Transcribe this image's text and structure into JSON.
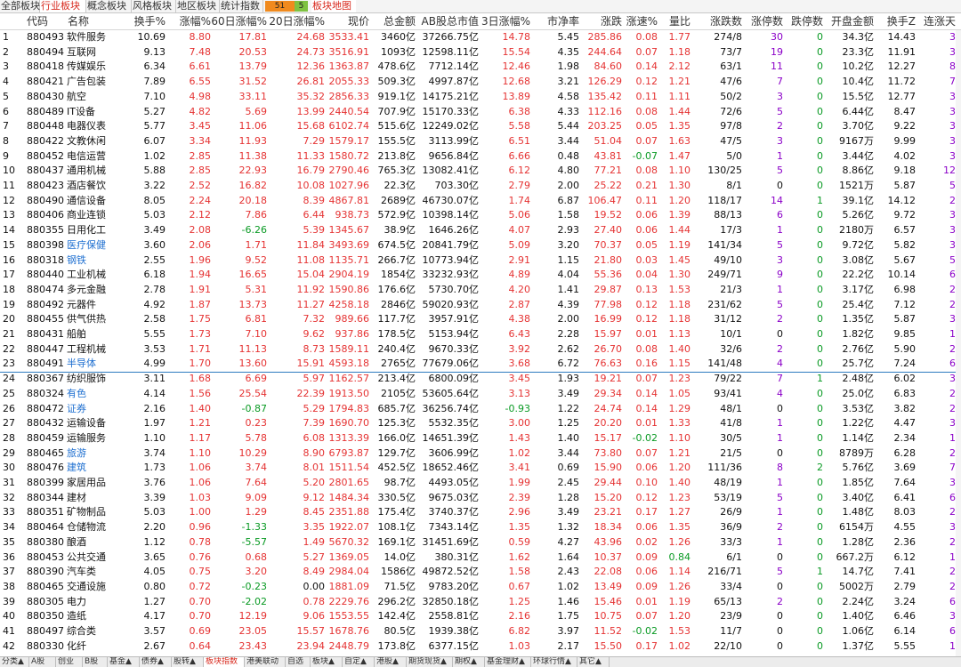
{
  "top_tabs": [
    "全部板块",
    "行业板块",
    "概念板块",
    "风格板块",
    "地区板块",
    "统计指数"
  ],
  "top_tab_extra": "板块地图",
  "badges": {
    "up": "51",
    "down": "5"
  },
  "colors": {
    "up": "#e53333",
    "down": "#0a9a24",
    "selected": "#2e7cc0",
    "accent": "#d82a1e"
  },
  "headers": [
    "代码",
    "名称",
    "换手%",
    "涨幅%",
    "60日涨幅%",
    "20日涨幅%",
    "现价",
    "总金额",
    "AB股总市值",
    "3日涨幅%",
    "市净率",
    "涨跌",
    "涨速%",
    "量比",
    "涨跌数",
    "涨停数",
    "跌停数",
    "开盘金额",
    "换手Z",
    "连涨天"
  ],
  "rows": [
    [
      "1",
      "880493",
      "软件服务",
      "10.69",
      "8.80",
      "17.81",
      "24.68",
      "3533.41",
      "3460亿",
      "37266.75亿",
      "14.78",
      "5.45",
      "285.86",
      "0.08",
      "1.77",
      "274/8",
      "30",
      "0",
      "34.3亿",
      "14.43",
      "3"
    ],
    [
      "2",
      "880494",
      "互联网",
      "9.13",
      "7.48",
      "20.53",
      "24.73",
      "3516.91",
      "1093亿",
      "12598.11亿",
      "15.54",
      "4.35",
      "244.64",
      "0.07",
      "1.18",
      "73/7",
      "19",
      "0",
      "23.3亿",
      "11.91",
      "3"
    ],
    [
      "3",
      "880418",
      "传媒娱乐",
      "6.34",
      "6.61",
      "13.79",
      "12.36",
      "1363.87",
      "478.6亿",
      "7712.14亿",
      "12.46",
      "1.98",
      "84.60",
      "0.14",
      "2.12",
      "63/1",
      "11",
      "0",
      "10.2亿",
      "12.27",
      "8"
    ],
    [
      "4",
      "880421",
      "广告包装",
      "7.89",
      "6.55",
      "31.52",
      "26.81",
      "2055.33",
      "509.3亿",
      "4997.87亿",
      "12.68",
      "3.21",
      "126.29",
      "0.12",
      "1.21",
      "47/6",
      "7",
      "0",
      "10.4亿",
      "11.72",
      "7"
    ],
    [
      "5",
      "880430",
      "航空",
      "7.10",
      "4.98",
      "33.11",
      "35.32",
      "2856.33",
      "919.1亿",
      "14175.21亿",
      "13.89",
      "4.58",
      "135.42",
      "0.11",
      "1.11",
      "50/2",
      "3",
      "0",
      "15.5亿",
      "12.77",
      "3"
    ],
    [
      "6",
      "880489",
      "IT设备",
      "5.27",
      "4.82",
      "5.69",
      "13.99",
      "2440.54",
      "707.9亿",
      "15170.33亿",
      "6.38",
      "4.33",
      "112.16",
      "0.08",
      "1.44",
      "72/6",
      "5",
      "0",
      "6.44亿",
      "8.47",
      "3"
    ],
    [
      "7",
      "880448",
      "电器仪表",
      "5.77",
      "3.45",
      "11.06",
      "15.68",
      "6102.74",
      "515.6亿",
      "12249.02亿",
      "5.58",
      "5.44",
      "203.25",
      "0.05",
      "1.35",
      "97/8",
      "2",
      "0",
      "3.70亿",
      "9.22",
      "3"
    ],
    [
      "8",
      "880422",
      "文教休闲",
      "6.07",
      "3.34",
      "11.93",
      "7.29",
      "1579.17",
      "155.5亿",
      "3113.99亿",
      "6.51",
      "3.44",
      "51.04",
      "0.07",
      "1.63",
      "47/5",
      "3",
      "0",
      "9167万",
      "9.99",
      "3"
    ],
    [
      "9",
      "880452",
      "电信运营",
      "1.02",
      "2.85",
      "11.38",
      "11.33",
      "1580.72",
      "213.8亿",
      "9656.84亿",
      "6.66",
      "0.48",
      "43.81",
      "-0.07",
      "1.47",
      "5/0",
      "1",
      "0",
      "3.44亿",
      "4.02",
      "3"
    ],
    [
      "10",
      "880437",
      "通用机械",
      "5.88",
      "2.85",
      "22.93",
      "16.79",
      "2790.46",
      "765.3亿",
      "13082.41亿",
      "6.12",
      "4.80",
      "77.21",
      "0.08",
      "1.10",
      "130/25",
      "5",
      "0",
      "8.86亿",
      "9.18",
      "12"
    ],
    [
      "11",
      "880423",
      "酒店餐饮",
      "3.22",
      "2.52",
      "16.82",
      "10.08",
      "1027.96",
      "22.3亿",
      "703.30亿",
      "2.79",
      "2.00",
      "25.22",
      "0.21",
      "1.30",
      "8/1",
      "0",
      "0",
      "1521万",
      "5.87",
      "5"
    ],
    [
      "12",
      "880490",
      "通信设备",
      "8.05",
      "2.24",
      "20.18",
      "8.39",
      "4867.81",
      "2689亿",
      "46730.07亿",
      "1.74",
      "6.87",
      "106.47",
      "0.11",
      "1.20",
      "118/17",
      "14",
      "1",
      "39.1亿",
      "14.12",
      "2"
    ],
    [
      "13",
      "880406",
      "商业连锁",
      "5.03",
      "2.12",
      "7.86",
      "6.44",
      "938.73",
      "572.9亿",
      "10398.14亿",
      "5.06",
      "1.58",
      "19.52",
      "0.06",
      "1.39",
      "88/13",
      "6",
      "0",
      "5.26亿",
      "9.72",
      "3"
    ],
    [
      "14",
      "880355",
      "日用化工",
      "3.49",
      "2.08",
      "-6.26",
      "5.39",
      "1345.67",
      "38.9亿",
      "1646.26亿",
      "4.07",
      "2.93",
      "27.40",
      "0.06",
      "1.44",
      "17/3",
      "1",
      "0",
      "2180万",
      "6.57",
      "3"
    ],
    [
      "15",
      "880398",
      "医疗保健",
      "3.60",
      "2.06",
      "1.71",
      "11.84",
      "3493.69",
      "674.5亿",
      "20841.79亿",
      "5.09",
      "3.20",
      "70.37",
      "0.05",
      "1.19",
      "141/34",
      "5",
      "0",
      "9.72亿",
      "5.82",
      "3"
    ],
    [
      "16",
      "880318",
      "钢铁",
      "2.55",
      "1.96",
      "9.52",
      "11.08",
      "1135.71",
      "266.7亿",
      "10773.94亿",
      "2.91",
      "1.15",
      "21.80",
      "0.03",
      "1.45",
      "49/10",
      "3",
      "0",
      "3.08亿",
      "5.67",
      "5"
    ],
    [
      "17",
      "880440",
      "工业机械",
      "6.18",
      "1.94",
      "16.65",
      "15.04",
      "2904.19",
      "1854亿",
      "33232.93亿",
      "4.89",
      "4.04",
      "55.36",
      "0.04",
      "1.30",
      "249/71",
      "9",
      "0",
      "22.2亿",
      "10.14",
      "6"
    ],
    [
      "18",
      "880474",
      "多元金融",
      "2.78",
      "1.91",
      "5.31",
      "11.92",
      "1590.86",
      "176.6亿",
      "5730.70亿",
      "4.20",
      "1.41",
      "29.87",
      "0.13",
      "1.53",
      "21/3",
      "1",
      "0",
      "3.17亿",
      "6.98",
      "2"
    ],
    [
      "19",
      "880492",
      "元器件",
      "4.92",
      "1.87",
      "13.73",
      "11.27",
      "4258.18",
      "2846亿",
      "59020.93亿",
      "2.87",
      "4.39",
      "77.98",
      "0.12",
      "1.18",
      "231/62",
      "5",
      "0",
      "25.4亿",
      "7.12",
      "2"
    ],
    [
      "20",
      "880455",
      "供气供热",
      "2.58",
      "1.75",
      "6.81",
      "7.32",
      "989.66",
      "117.7亿",
      "3957.91亿",
      "4.38",
      "2.00",
      "16.99",
      "0.12",
      "1.18",
      "31/12",
      "2",
      "0",
      "1.35亿",
      "5.87",
      "3"
    ],
    [
      "21",
      "880431",
      "船舶",
      "5.55",
      "1.73",
      "7.10",
      "9.62",
      "937.86",
      "178.5亿",
      "5153.94亿",
      "6.43",
      "2.28",
      "15.97",
      "0.01",
      "1.13",
      "10/1",
      "0",
      "0",
      "1.82亿",
      "9.85",
      "1"
    ],
    [
      "22",
      "880447",
      "工程机械",
      "3.53",
      "1.71",
      "11.13",
      "8.73",
      "1589.11",
      "240.4亿",
      "9670.33亿",
      "3.92",
      "2.62",
      "26.70",
      "0.08",
      "1.40",
      "32/6",
      "2",
      "0",
      "2.76亿",
      "5.90",
      "2"
    ],
    [
      "23",
      "880491",
      "半导体",
      "4.99",
      "1.70",
      "13.60",
      "15.91",
      "4593.18",
      "2765亿",
      "77679.06亿",
      "3.68",
      "6.72",
      "76.63",
      "0.16",
      "1.15",
      "141/48",
      "4",
      "0",
      "25.7亿",
      "7.24",
      "6"
    ],
    [
      "24",
      "880367",
      "纺织服饰",
      "3.11",
      "1.68",
      "6.69",
      "5.97",
      "1162.57",
      "213.4亿",
      "6800.09亿",
      "3.45",
      "1.93",
      "19.21",
      "0.07",
      "1.23",
      "79/22",
      "7",
      "1",
      "2.48亿",
      "6.02",
      "3"
    ],
    [
      "25",
      "880324",
      "有色",
      "4.14",
      "1.56",
      "25.54",
      "22.39",
      "1913.50",
      "2105亿",
      "53605.64亿",
      "3.13",
      "3.49",
      "29.34",
      "0.14",
      "1.05",
      "93/41",
      "4",
      "0",
      "25.0亿",
      "6.83",
      "2"
    ],
    [
      "26",
      "880472",
      "证券",
      "2.16",
      "1.40",
      "-0.87",
      "5.29",
      "1794.83",
      "685.7亿",
      "36256.74亿",
      "-0.93",
      "1.22",
      "24.74",
      "0.14",
      "1.29",
      "48/1",
      "0",
      "0",
      "3.53亿",
      "3.82",
      "2"
    ],
    [
      "27",
      "880432",
      "运输设备",
      "1.97",
      "1.21",
      "0.23",
      "7.39",
      "1690.70",
      "125.3亿",
      "5532.35亿",
      "3.00",
      "1.25",
      "20.20",
      "0.01",
      "1.33",
      "41/8",
      "1",
      "0",
      "1.22亿",
      "4.47",
      "3"
    ],
    [
      "28",
      "880459",
      "运输服务",
      "1.10",
      "1.17",
      "5.78",
      "6.08",
      "1313.39",
      "166.0亿",
      "14651.39亿",
      "1.43",
      "1.40",
      "15.17",
      "-0.02",
      "1.10",
      "30/5",
      "1",
      "0",
      "1.14亿",
      "2.34",
      "1"
    ],
    [
      "29",
      "880465",
      "旅游",
      "3.74",
      "1.10",
      "10.29",
      "8.90",
      "6793.87",
      "129.7亿",
      "3606.99亿",
      "1.02",
      "3.44",
      "73.80",
      "0.07",
      "1.21",
      "21/5",
      "0",
      "0",
      "8789万",
      "6.28",
      "2"
    ],
    [
      "30",
      "880476",
      "建筑",
      "1.73",
      "1.06",
      "3.74",
      "8.01",
      "1511.54",
      "452.5亿",
      "18652.46亿",
      "3.41",
      "0.69",
      "15.90",
      "0.06",
      "1.20",
      "111/36",
      "8",
      "2",
      "5.76亿",
      "3.69",
      "7"
    ],
    [
      "31",
      "880399",
      "家居用品",
      "3.76",
      "1.06",
      "7.64",
      "5.20",
      "2801.65",
      "98.7亿",
      "4493.05亿",
      "1.99",
      "2.45",
      "29.44",
      "0.10",
      "1.40",
      "48/19",
      "1",
      "0",
      "1.85亿",
      "7.64",
      "3"
    ],
    [
      "32",
      "880344",
      "建材",
      "3.39",
      "1.03",
      "9.09",
      "9.12",
      "1484.34",
      "330.5亿",
      "9675.03亿",
      "2.39",
      "1.28",
      "15.20",
      "0.12",
      "1.23",
      "53/19",
      "5",
      "0",
      "3.40亿",
      "6.41",
      "6"
    ],
    [
      "33",
      "880351",
      "矿物制品",
      "5.03",
      "1.00",
      "1.29",
      "8.45",
      "2351.88",
      "175.4亿",
      "3740.37亿",
      "2.96",
      "3.49",
      "23.21",
      "0.17",
      "1.27",
      "26/9",
      "1",
      "0",
      "1.48亿",
      "8.03",
      "2"
    ],
    [
      "34",
      "880464",
      "仓储物流",
      "2.20",
      "0.96",
      "-1.33",
      "3.35",
      "1922.07",
      "108.1亿",
      "7343.14亿",
      "1.35",
      "1.32",
      "18.34",
      "0.06",
      "1.35",
      "36/9",
      "2",
      "0",
      "6154万",
      "4.55",
      "3"
    ],
    [
      "35",
      "880380",
      "酿酒",
      "1.12",
      "0.78",
      "-5.57",
      "1.49",
      "5670.32",
      "169.1亿",
      "31451.69亿",
      "0.59",
      "4.27",
      "43.96",
      "0.02",
      "1.26",
      "33/3",
      "1",
      "0",
      "1.28亿",
      "2.36",
      "2"
    ],
    [
      "36",
      "880453",
      "公共交通",
      "3.65",
      "0.76",
      "0.68",
      "5.27",
      "1369.05",
      "14.0亿",
      "380.31亿",
      "1.62",
      "1.64",
      "10.37",
      "0.09",
      "0.84",
      "6/1",
      "0",
      "0",
      "667.2万",
      "6.12",
      "1"
    ],
    [
      "37",
      "880390",
      "汽车类",
      "4.05",
      "0.75",
      "3.20",
      "8.49",
      "2984.04",
      "1586亿",
      "49872.52亿",
      "1.58",
      "2.43",
      "22.08",
      "0.06",
      "1.14",
      "216/71",
      "5",
      "1",
      "14.7亿",
      "7.41",
      "2"
    ],
    [
      "38",
      "880465",
      "交通设施",
      "0.80",
      "0.72",
      "-0.23",
      "0.00",
      "1881.09",
      "71.5亿",
      "9783.20亿",
      "0.67",
      "1.02",
      "13.49",
      "0.09",
      "1.26",
      "33/4",
      "0",
      "0",
      "5002万",
      "2.79",
      "2"
    ],
    [
      "39",
      "880305",
      "电力",
      "1.27",
      "0.70",
      "-2.02",
      "0.78",
      "2229.76",
      "296.2亿",
      "32850.18亿",
      "1.25",
      "1.46",
      "15.46",
      "0.01",
      "1.19",
      "65/13",
      "2",
      "0",
      "2.24亿",
      "3.24",
      "6"
    ],
    [
      "40",
      "880350",
      "造纸",
      "4.17",
      "0.70",
      "12.19",
      "9.06",
      "1553.55",
      "142.4亿",
      "2558.81亿",
      "2.16",
      "1.75",
      "10.75",
      "0.07",
      "1.20",
      "23/9",
      "0",
      "0",
      "1.40亿",
      "6.46",
      "3"
    ],
    [
      "41",
      "880497",
      "综合类",
      "3.57",
      "0.69",
      "23.05",
      "15.57",
      "1678.76",
      "80.5亿",
      "1939.38亿",
      "6.82",
      "3.97",
      "11.52",
      "-0.02",
      "1.53",
      "11/7",
      "0",
      "0",
      "1.06亿",
      "6.14",
      "6"
    ],
    [
      "42",
      "880330",
      "化纤",
      "2.67",
      "0.64",
      "23.43",
      "23.94",
      "2448.79",
      "173.8亿",
      "6377.15亿",
      "1.03",
      "2.17",
      "15.50",
      "0.17",
      "1.02",
      "22/10",
      "0",
      "0",
      "1.37亿",
      "5.55",
      "1"
    ]
  ],
  "bottom_tabs": [
    "分类▲",
    "A股",
    "创业",
    "B股",
    "基金▲",
    "债券▲",
    "股转▲",
    "板块指数",
    "港美联动",
    "自选",
    "板块▲",
    "自定▲",
    "港股▲",
    "期货现货▲",
    "期权▲",
    "基金理财▲",
    "环球行情▲",
    "其它▲"
  ]
}
